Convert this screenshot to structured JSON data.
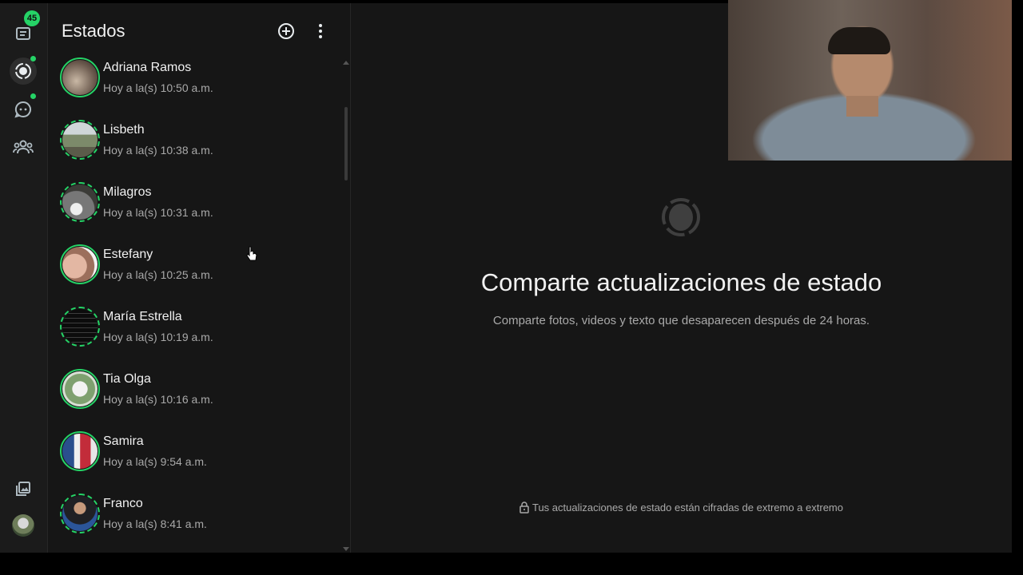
{
  "sidebar": {
    "chats_badge": "45",
    "icons": [
      "chats-icon",
      "status-icon",
      "channels-icon",
      "communities-icon",
      "media-icon",
      "profile-avatar"
    ]
  },
  "panel": {
    "title": "Estados",
    "add_icon": "add-circle-icon",
    "menu_icon": "more-vertical-icon"
  },
  "statuses": [
    {
      "name": "Adriana Ramos",
      "time": "Hoy a la(s) 10:50 a.m."
    },
    {
      "name": "Lisbeth",
      "time": "Hoy a la(s) 10:38 a.m."
    },
    {
      "name": "Milagros",
      "time": "Hoy a la(s) 10:31 a.m."
    },
    {
      "name": "Estefany",
      "time": "Hoy a la(s) 10:25 a.m."
    },
    {
      "name": "María Estrella",
      "time": "Hoy a la(s) 10:19 a.m."
    },
    {
      "name": "Tia Olga",
      "time": "Hoy a la(s) 10:16 a.m."
    },
    {
      "name": "Samira",
      "time": "Hoy a la(s) 9:54 a.m."
    },
    {
      "name": "Franco",
      "time": "Hoy a la(s) 8:41 a.m."
    }
  ],
  "main": {
    "title": "Comparte actualizaciones de estado",
    "subtitle": "Comparte fotos, videos y texto que desaparecen después de 24 horas.",
    "footer": "Tus actualizaciones de estado están cifradas de extremo a extremo"
  },
  "colors": {
    "accent": "#25d366",
    "background": "#161616",
    "rail": "#1b1b1b"
  }
}
